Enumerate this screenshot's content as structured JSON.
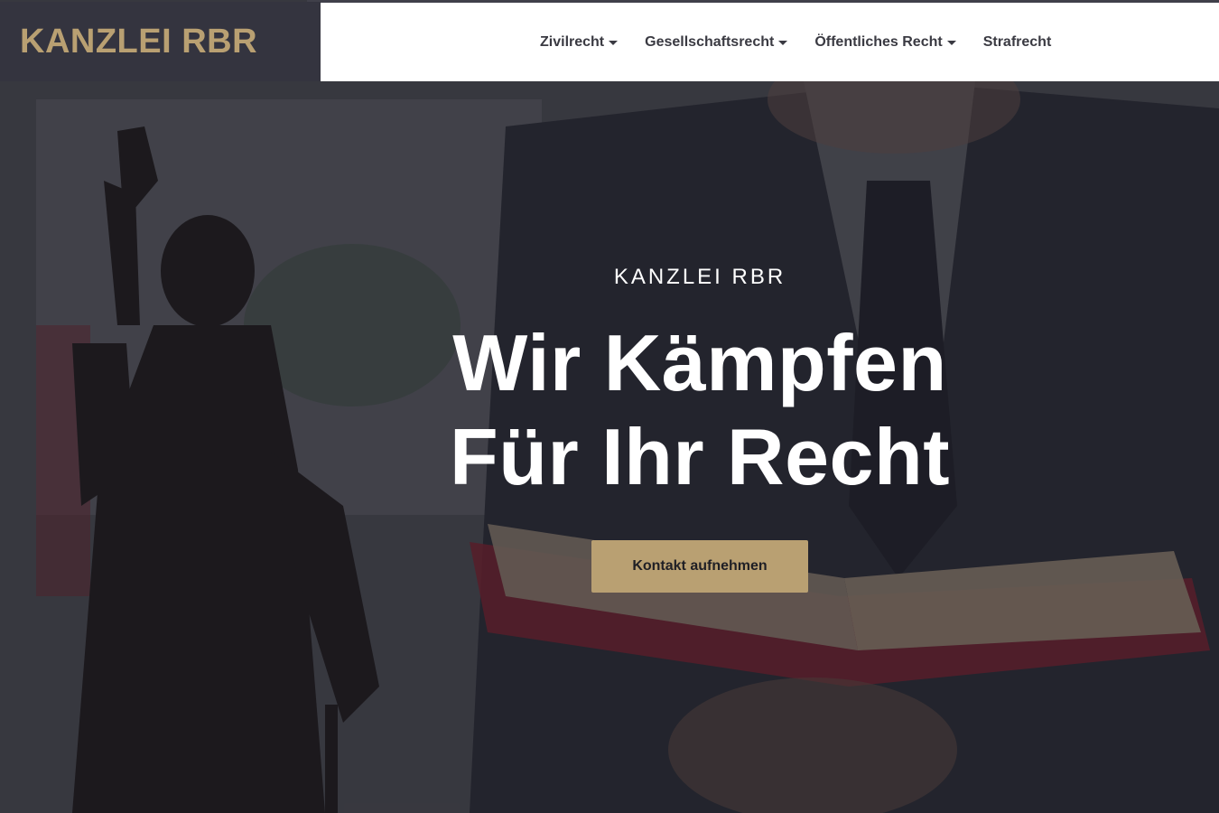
{
  "brand": {
    "name": "KANZLEI RBR",
    "color": "#b9a072"
  },
  "nav": {
    "items": [
      {
        "label": "Zivilrecht",
        "has_dropdown": true
      },
      {
        "label": "Gesellschaftsrecht",
        "has_dropdown": true
      },
      {
        "label": "Öffentliches Recht",
        "has_dropdown": true
      },
      {
        "label": "Strafrecht",
        "has_dropdown": false
      }
    ]
  },
  "hero": {
    "eyebrow": "KANZLEI RBR",
    "headline_line1": "Wir Kämpfen",
    "headline_line2": "Für Ihr Recht",
    "cta_label": "Kontakt aufnehmen",
    "background_subject": "justitia-statue-and-lawyer-reading-book"
  },
  "colors": {
    "accent": "#b9a072",
    "brand_bg": "#34343f",
    "nav_bg": "#ffffff",
    "nav_text": "#3a3a42",
    "book_red": "#a02030"
  }
}
